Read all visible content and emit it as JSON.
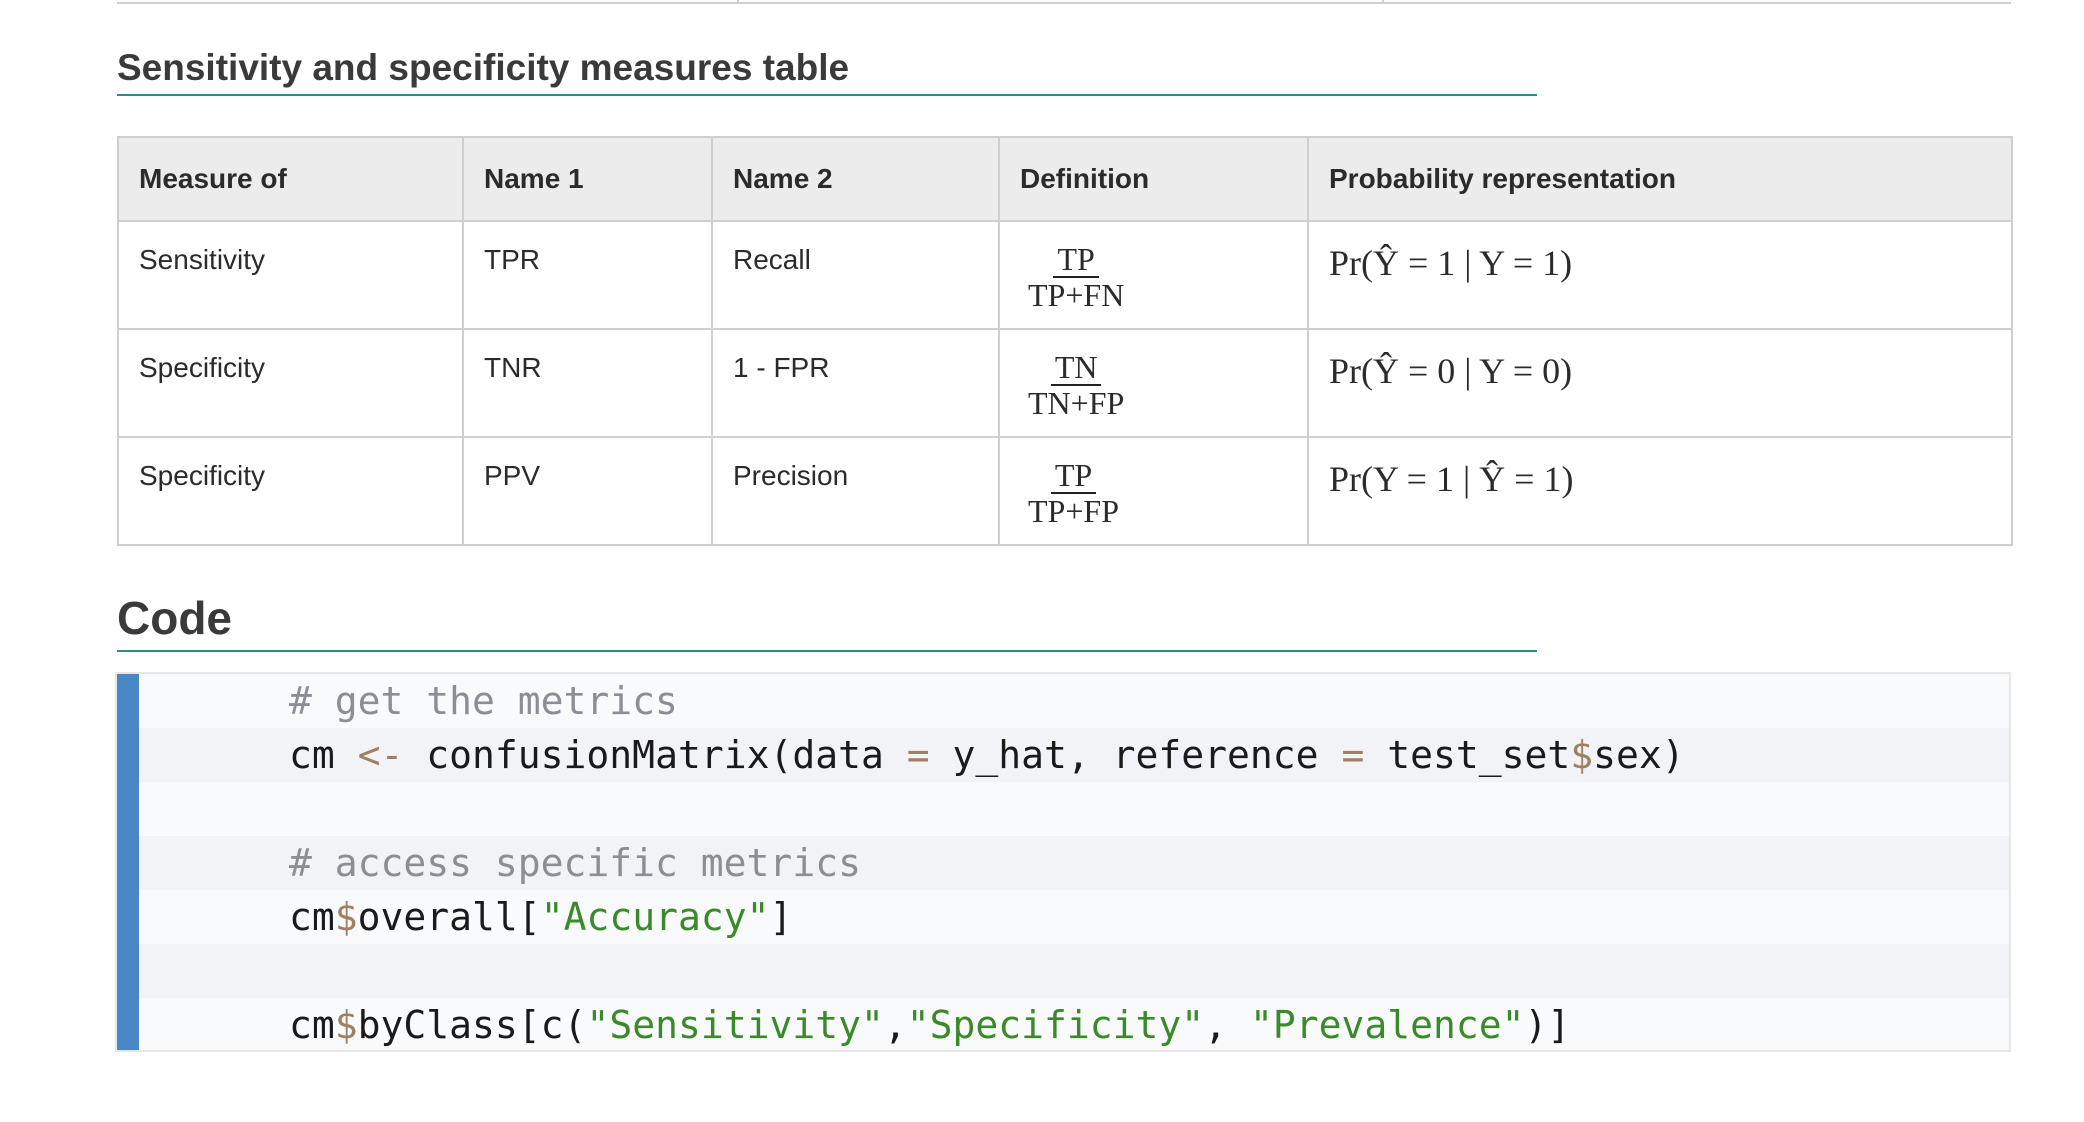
{
  "headings": {
    "table_title": "Sensitivity and specificity measures table",
    "code_title": "Code"
  },
  "table": {
    "headers": [
      "Measure of",
      "Name 1",
      "Name 2",
      "Definition",
      "Probability representation"
    ],
    "rows": [
      {
        "measure": "Sensitivity",
        "name1": "TPR",
        "name2": "Recall",
        "def_num": "TP",
        "def_den": "TP+FN",
        "prob": "Pr(Ŷ = 1 | Y = 1)"
      },
      {
        "measure": "Specificity",
        "name1": "TNR",
        "name2": "1 - FPR",
        "def_num": "TN",
        "def_den": "TN+FP",
        "prob": "Pr(Ŷ = 0 | Y = 0)"
      },
      {
        "measure": "Specificity",
        "name1": "PPV",
        "name2": "Precision",
        "def_num": "TP",
        "def_den": "TP+FP",
        "prob": "Pr(Y = 1 | Ŷ = 1)"
      }
    ]
  },
  "code": {
    "accent_color": "#4a87c6",
    "lines": [
      [
        {
          "t": "comment",
          "v": "# get the metrics"
        }
      ],
      [
        {
          "t": "plain",
          "v": "cm "
        },
        {
          "t": "op",
          "v": "<-"
        },
        {
          "t": "plain",
          "v": " confusionMatrix(data "
        },
        {
          "t": "op",
          "v": "="
        },
        {
          "t": "plain",
          "v": " y_hat, reference "
        },
        {
          "t": "op",
          "v": "="
        },
        {
          "t": "plain",
          "v": " test_set"
        },
        {
          "t": "op",
          "v": "$"
        },
        {
          "t": "plain",
          "v": "sex)"
        }
      ],
      [],
      [
        {
          "t": "comment",
          "v": "# access specific metrics"
        }
      ],
      [
        {
          "t": "plain",
          "v": "cm"
        },
        {
          "t": "op",
          "v": "$"
        },
        {
          "t": "plain",
          "v": "overall["
        },
        {
          "t": "str",
          "v": "\"Accuracy\""
        },
        {
          "t": "plain",
          "v": "]"
        }
      ],
      [],
      [
        {
          "t": "plain",
          "v": "cm"
        },
        {
          "t": "op",
          "v": "$"
        },
        {
          "t": "plain",
          "v": "byClass[c("
        },
        {
          "t": "str",
          "v": "\"Sensitivity\""
        },
        {
          "t": "plain",
          "v": ","
        },
        {
          "t": "str",
          "v": "\"Specificity\""
        },
        {
          "t": "plain",
          "v": ", "
        },
        {
          "t": "str",
          "v": "\"Prevalence\""
        },
        {
          "t": "plain",
          "v": ")]"
        }
      ]
    ]
  }
}
